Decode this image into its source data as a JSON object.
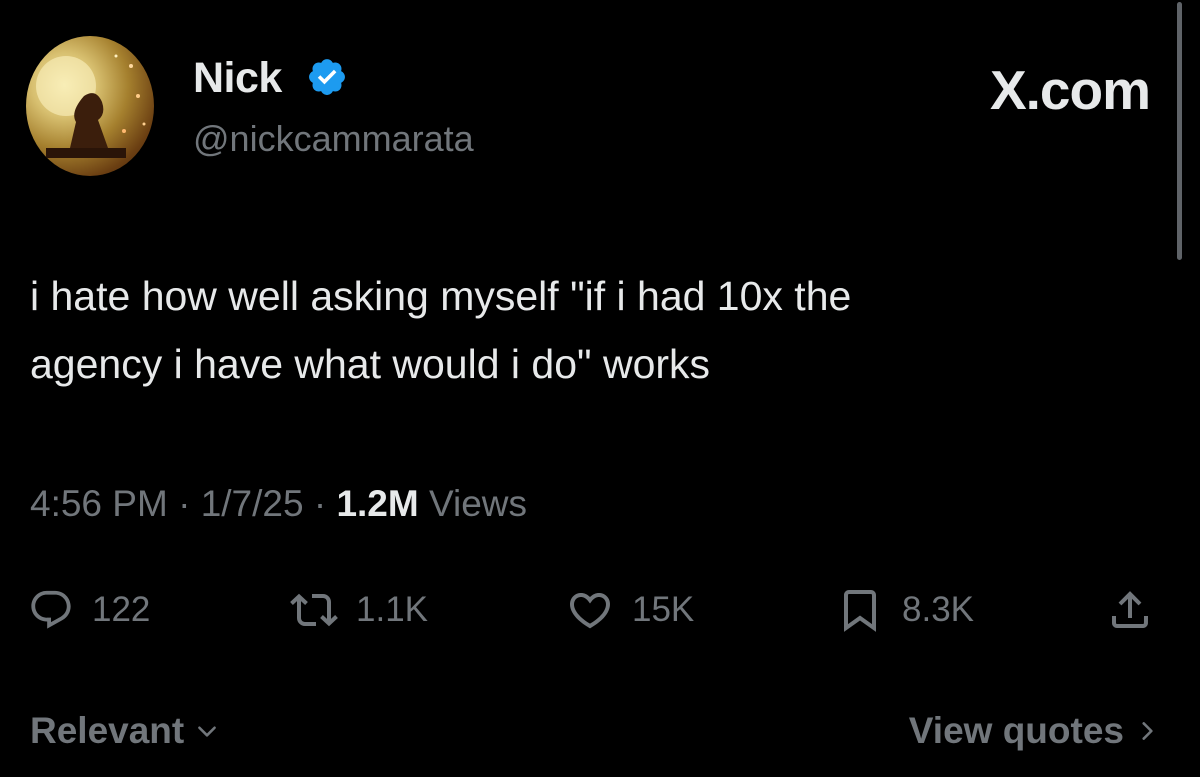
{
  "author": {
    "display_name": "Nick",
    "handle": "@nickcammarata",
    "verified": true
  },
  "brand": "X.com",
  "tweet": {
    "text_line1": "i hate how well asking myself \"if i had 10x the",
    "text_line2": "agency i have what would i do\" works"
  },
  "meta": {
    "time": "4:56 PM",
    "date": "1/7/25",
    "views_count": "1.2M",
    "views_label": "Views"
  },
  "actions": {
    "replies": "122",
    "reposts": "1.1K",
    "likes": "15K",
    "bookmarks": "8.3K"
  },
  "footer": {
    "sort_label": "Relevant",
    "quotes_label": "View quotes"
  },
  "icons": {
    "verified": "verified-badge-icon",
    "reply": "reply-bubble-icon",
    "repost": "repost-icon",
    "like": "heart-icon",
    "bookmark": "bookmark-icon",
    "share": "share-upload-icon"
  },
  "colors": {
    "background": "#000000",
    "primary_text": "#e7e9ea",
    "secondary_text": "#71767b",
    "verified_blue": "#1d9bf0"
  }
}
